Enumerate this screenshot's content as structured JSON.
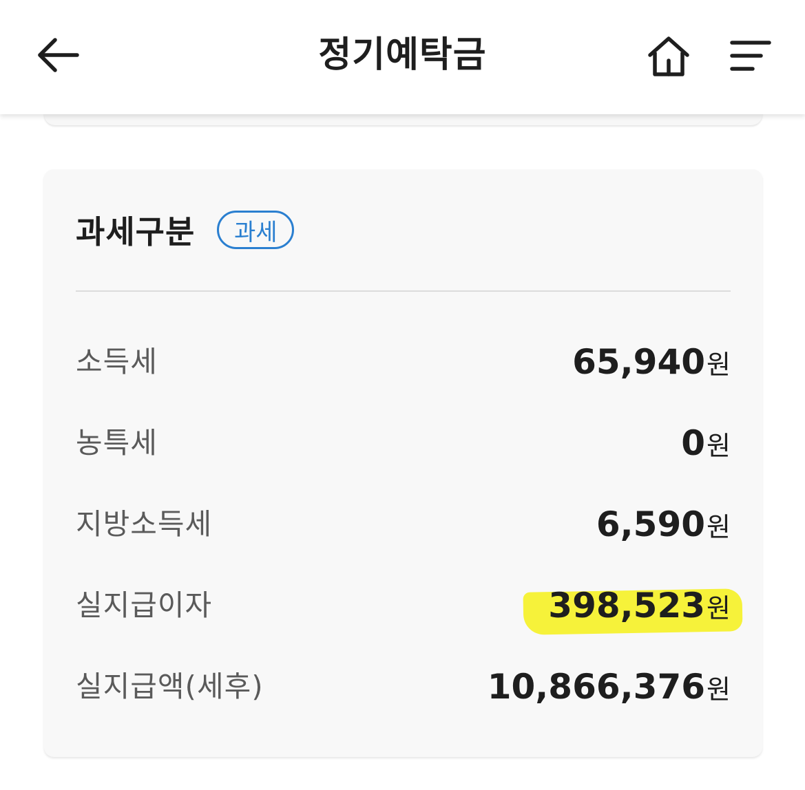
{
  "header": {
    "title": "정기예탁금",
    "back_icon": "back-arrow-icon",
    "home_icon": "home-icon",
    "menu_icon": "menu-icon"
  },
  "tax_card": {
    "title": "과세구분",
    "badge": "과세",
    "rows": [
      {
        "label": "소득세",
        "amount": "65,940",
        "unit": "원"
      },
      {
        "label": "농특세",
        "amount": "0",
        "unit": "원"
      },
      {
        "label": "지방소득세",
        "amount": "6,590",
        "unit": "원"
      },
      {
        "label": "실지급이자",
        "amount": "398,523",
        "unit": "원",
        "highlighted": true
      },
      {
        "label": "실지급액(세후)",
        "amount": "10,866,376",
        "unit": "원"
      }
    ]
  },
  "colors": {
    "accent": "#2a7fd0",
    "highlight": "#f6f23a",
    "card_background": "#f8f8f8"
  }
}
